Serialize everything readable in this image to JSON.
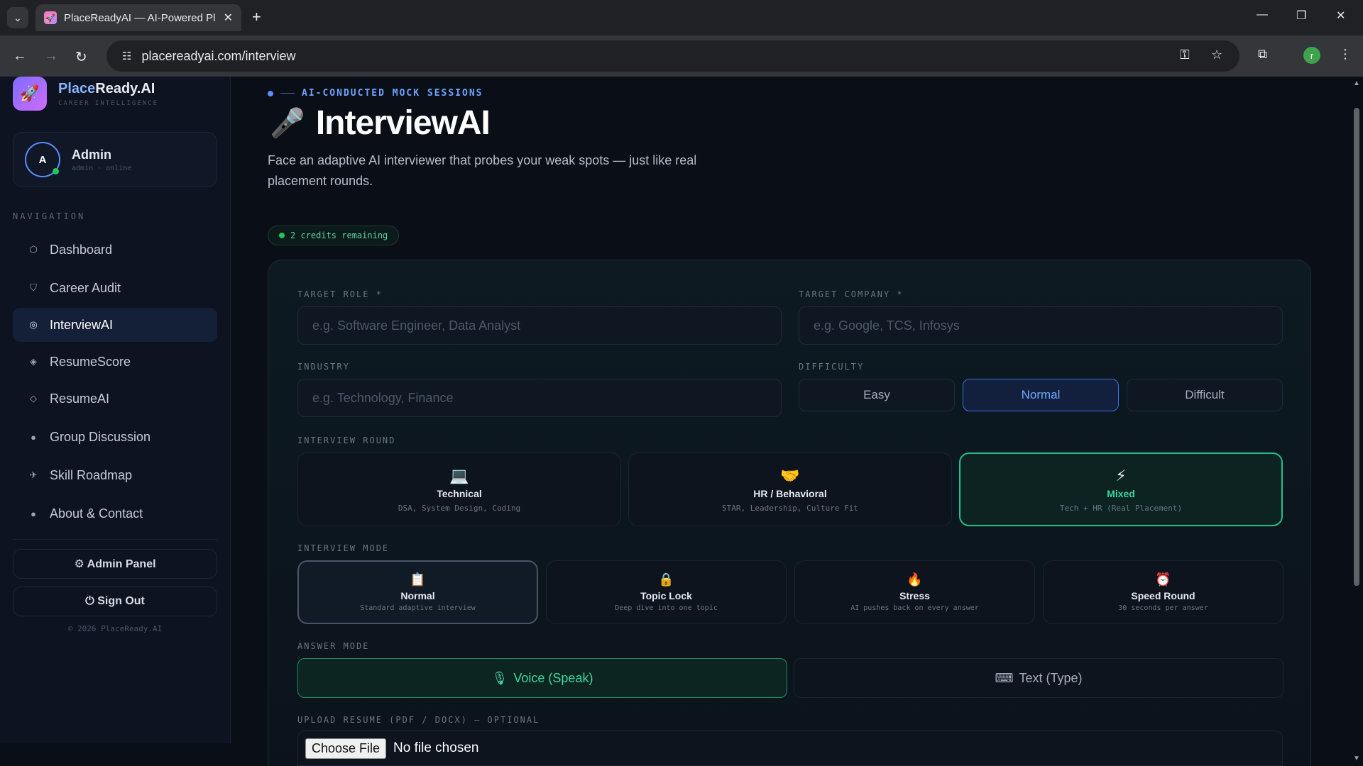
{
  "browser": {
    "tab_title": "PlaceReadyAI — AI-Powered Pl",
    "url": "placereadyai.com/interview",
    "profile_initial": "r"
  },
  "brand": {
    "name_accent": "Place",
    "name_rest": "Ready.AI",
    "tagline": "CAREER INTELLIGENCE"
  },
  "user": {
    "initial": "A",
    "name": "Admin",
    "status": "admin · online"
  },
  "sidebar": {
    "heading": "NAVIGATION",
    "items": [
      {
        "label": "Dashboard",
        "icon": "⬡"
      },
      {
        "label": "Career Audit",
        "icon": "⛉"
      },
      {
        "label": "InterviewAI",
        "icon": "◎"
      },
      {
        "label": "ResumeScore",
        "icon": "◈"
      },
      {
        "label": "ResumeAI",
        "icon": "◇"
      },
      {
        "label": "Group Discussion",
        "icon": "●"
      },
      {
        "label": "Skill Roadmap",
        "icon": "✈"
      },
      {
        "label": "About & Contact",
        "icon": "●"
      }
    ],
    "admin_panel": "⚙ Admin Panel",
    "sign_out": "⏻ Sign Out",
    "copyright": "© 2026 PlaceReady.AI"
  },
  "header": {
    "eyebrow": "AI-CONDUCTED MOCK SESSIONS",
    "title": "InterviewAI",
    "description": "Face an adaptive AI interviewer that probes your weak spots — just like real placement rounds.",
    "credits": "2 credits remaining"
  },
  "form": {
    "target_role_label": "TARGET ROLE *",
    "target_role_placeholder": "e.g. Software Engineer, Data Analyst",
    "target_company_label": "TARGET COMPANY *",
    "target_company_placeholder": "e.g. Google, TCS, Infosys",
    "industry_label": "INDUSTRY",
    "industry_placeholder": "e.g. Technology, Finance",
    "difficulty_label": "DIFFICULTY",
    "difficulty_options": [
      "Easy",
      "Normal",
      "Difficult"
    ],
    "difficulty_selected": "Normal",
    "round_label": "INTERVIEW ROUND",
    "rounds": [
      {
        "icon": "💻",
        "name": "Technical",
        "desc": "DSA, System Design, Coding"
      },
      {
        "icon": "🤝",
        "name": "HR / Behavioral",
        "desc": "STAR, Leadership, Culture Fit"
      },
      {
        "icon": "⚡",
        "name": "Mixed",
        "desc": "Tech + HR (Real Placement)"
      }
    ],
    "round_selected": "Mixed",
    "mode_label": "INTERVIEW MODE",
    "modes": [
      {
        "icon": "📋",
        "name": "Normal",
        "desc": "Standard adaptive interview"
      },
      {
        "icon": "🔒",
        "name": "Topic Lock",
        "desc": "Deep dive into one topic"
      },
      {
        "icon": "🔥",
        "name": "Stress",
        "desc": "AI pushes back on every answer"
      },
      {
        "icon": "⏰",
        "name": "Speed Round",
        "desc": "30 seconds per answer"
      }
    ],
    "mode_selected": "Normal",
    "answer_label": "ANSWER MODE",
    "answer_options": [
      {
        "icon": "🎙",
        "label": "Voice (Speak)"
      },
      {
        "icon": "⌨",
        "label": "Text (Type)"
      }
    ],
    "answer_selected": "Voice (Speak)",
    "upload_label": "UPLOAD RESUME (PDF / DOCX) — OPTIONAL",
    "choose_file": "Choose File",
    "file_status": "No file chosen"
  }
}
